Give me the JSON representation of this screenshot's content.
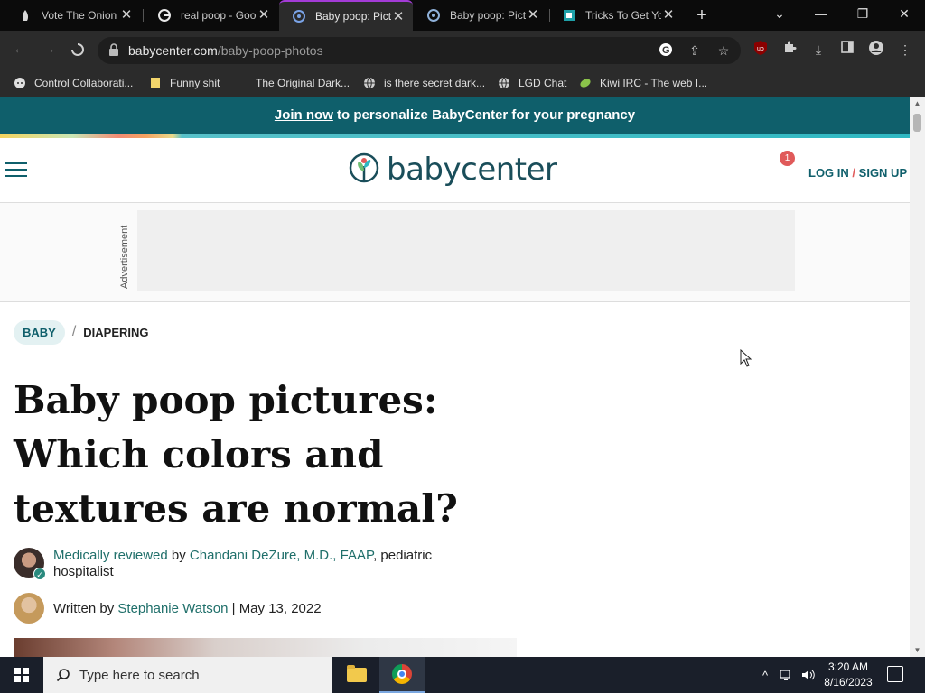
{
  "browser": {
    "tabs": [
      {
        "title": "Vote The Onion",
        "icon": "onion-icon"
      },
      {
        "title": "real poop - Goo",
        "icon": "google-icon"
      },
      {
        "title": "Baby poop: Pictu",
        "icon": "babycenter-icon",
        "active": true
      },
      {
        "title": "Baby poop: Pictu",
        "icon": "babycenter-icon"
      },
      {
        "title": "Tricks To Get You",
        "icon": "site-icon"
      }
    ],
    "url_domain": "babycenter.com",
    "url_path": "/baby-poop-photos",
    "extension_badge": "uo"
  },
  "bookmarks": [
    {
      "label": "Control Collaborati...",
      "icon": "octocat-icon"
    },
    {
      "label": "Funny shit",
      "icon": "folder-icon"
    },
    {
      "label": "The Original Dark...",
      "icon": "blank-icon"
    },
    {
      "label": "is there secret dark...",
      "icon": "globe-icon"
    },
    {
      "label": "LGD Chat",
      "icon": "globe-icon"
    },
    {
      "label": "Kiwi IRC - The web I...",
      "icon": "kiwi-icon"
    }
  ],
  "page": {
    "promo_link": "Join now",
    "promo_rest": " to personalize BabyCenter for your pregnancy",
    "logo_text": "babycenter",
    "notification_count": "1",
    "login": "LOG IN",
    "signup": "SIGN UP",
    "login_sep": "/",
    "ad_label": "Advertisement",
    "breadcrumb_1": "BABY",
    "breadcrumb_sep": "/",
    "breadcrumb_2": "DIAPERING",
    "title": "Baby poop pictures: Which colors and textures are normal?",
    "reviewed_label": "Medically reviewed",
    "reviewed_by": " by ",
    "reviewer": "Chandani DeZure, M.D., FAAP",
    "reviewer_role": ", pediatric hospitalist",
    "written_by": "Written by ",
    "author": "Stephanie Watson",
    "date_sep": " | ",
    "date": "May 13, 2022"
  },
  "taskbar": {
    "search_placeholder": "Type here to search",
    "time": "3:20 AM",
    "date": "8/16/2023"
  },
  "colors": {
    "brand_teal": "#0f5f6b",
    "link": "#1f6f6a",
    "badge_red": "#e05a5a",
    "tab_accent": "#a33bd6"
  }
}
